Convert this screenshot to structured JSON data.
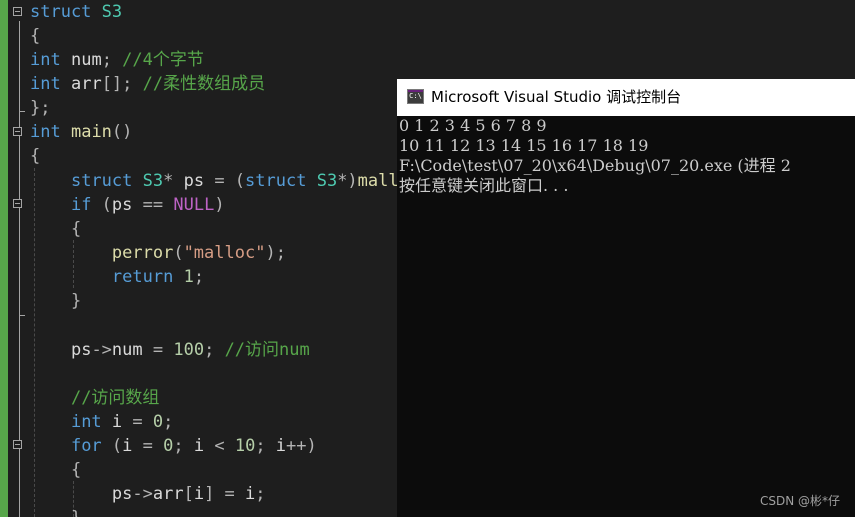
{
  "editor": {
    "lines": [
      {
        "tokens": [
          {
            "t": "struct",
            "c": "kw"
          },
          {
            "t": " "
          },
          {
            "t": "S3",
            "c": "ty"
          }
        ]
      },
      {
        "tokens": [
          {
            "t": "{",
            "c": "pn"
          }
        ]
      },
      {
        "tokens": [
          {
            "t": "int",
            "c": "kw"
          },
          {
            "t": " "
          },
          {
            "t": "num",
            "c": "id"
          },
          {
            "t": "; ",
            "c": "pn"
          },
          {
            "t": "//4个字节",
            "c": "cm"
          }
        ]
      },
      {
        "tokens": [
          {
            "t": "int",
            "c": "kw"
          },
          {
            "t": " "
          },
          {
            "t": "arr",
            "c": "id"
          },
          {
            "t": "[]; ",
            "c": "pn"
          },
          {
            "t": "//柔性数组成员",
            "c": "cm"
          }
        ]
      },
      {
        "tokens": [
          {
            "t": "};",
            "c": "pn"
          }
        ]
      },
      {
        "tokens": [
          {
            "t": "int",
            "c": "kw"
          },
          {
            "t": " "
          },
          {
            "t": "main",
            "c": "fn"
          },
          {
            "t": "()",
            "c": "pn"
          }
        ]
      },
      {
        "tokens": [
          {
            "t": "{",
            "c": "pn"
          }
        ]
      },
      {
        "tokens": [
          {
            "t": "    "
          },
          {
            "t": "struct",
            "c": "kw"
          },
          {
            "t": " "
          },
          {
            "t": "S3",
            "c": "ty"
          },
          {
            "t": "* ",
            "c": "pn"
          },
          {
            "t": "ps",
            "c": "id"
          },
          {
            "t": " = (",
            "c": "pn"
          },
          {
            "t": "struct",
            "c": "kw"
          },
          {
            "t": " "
          },
          {
            "t": "S3",
            "c": "ty"
          },
          {
            "t": "*)",
            "c": "pn"
          },
          {
            "t": "malloc",
            "c": "fn"
          }
        ]
      },
      {
        "tokens": [
          {
            "t": "    "
          },
          {
            "t": "if",
            "c": "kw"
          },
          {
            "t": " (",
            "c": "pn"
          },
          {
            "t": "ps",
            "c": "id"
          },
          {
            "t": " == ",
            "c": "pn"
          },
          {
            "t": "NULL",
            "c": "mac"
          },
          {
            "t": ")",
            "c": "pn"
          }
        ]
      },
      {
        "tokens": [
          {
            "t": "    "
          },
          {
            "t": "{",
            "c": "pn"
          }
        ]
      },
      {
        "tokens": [
          {
            "t": "        "
          },
          {
            "t": "perror",
            "c": "fn"
          },
          {
            "t": "(",
            "c": "pn"
          },
          {
            "t": "\"malloc\"",
            "c": "st"
          },
          {
            "t": ");",
            "c": "pn"
          }
        ]
      },
      {
        "tokens": [
          {
            "t": "        "
          },
          {
            "t": "return",
            "c": "kw"
          },
          {
            "t": " "
          },
          {
            "t": "1",
            "c": "nm"
          },
          {
            "t": ";",
            "c": "pn"
          }
        ]
      },
      {
        "tokens": [
          {
            "t": "    "
          },
          {
            "t": "}",
            "c": "pn"
          }
        ]
      },
      {
        "tokens": []
      },
      {
        "tokens": [
          {
            "t": "    "
          },
          {
            "t": "ps",
            "c": "id"
          },
          {
            "t": "->",
            "c": "pn"
          },
          {
            "t": "num",
            "c": "id"
          },
          {
            "t": " = ",
            "c": "pn"
          },
          {
            "t": "100",
            "c": "nm"
          },
          {
            "t": "; ",
            "c": "pn"
          },
          {
            "t": "//访问num",
            "c": "cm"
          }
        ]
      },
      {
        "tokens": []
      },
      {
        "tokens": [
          {
            "t": "    "
          },
          {
            "t": "//访问数组",
            "c": "cm"
          }
        ]
      },
      {
        "tokens": [
          {
            "t": "    "
          },
          {
            "t": "int",
            "c": "kw"
          },
          {
            "t": " "
          },
          {
            "t": "i",
            "c": "id"
          },
          {
            "t": " = ",
            "c": "pn"
          },
          {
            "t": "0",
            "c": "nm"
          },
          {
            "t": ";",
            "c": "pn"
          }
        ]
      },
      {
        "tokens": [
          {
            "t": "    "
          },
          {
            "t": "for",
            "c": "kw"
          },
          {
            "t": " (",
            "c": "pn"
          },
          {
            "t": "i",
            "c": "id"
          },
          {
            "t": " = ",
            "c": "pn"
          },
          {
            "t": "0",
            "c": "nm"
          },
          {
            "t": "; ",
            "c": "pn"
          },
          {
            "t": "i",
            "c": "id"
          },
          {
            "t": " < ",
            "c": "pn"
          },
          {
            "t": "10",
            "c": "nm"
          },
          {
            "t": "; ",
            "c": "pn"
          },
          {
            "t": "i",
            "c": "id"
          },
          {
            "t": "++)",
            "c": "pn"
          }
        ]
      },
      {
        "tokens": [
          {
            "t": "    "
          },
          {
            "t": "{",
            "c": "pn"
          }
        ]
      },
      {
        "tokens": [
          {
            "t": "        "
          },
          {
            "t": "ps",
            "c": "id"
          },
          {
            "t": "->",
            "c": "pn"
          },
          {
            "t": "arr",
            "c": "id"
          },
          {
            "t": "[",
            "c": "pn"
          },
          {
            "t": "i",
            "c": "id"
          },
          {
            "t": "] = ",
            "c": "pn"
          },
          {
            "t": "i",
            "c": "id"
          },
          {
            "t": ";",
            "c": "pn"
          }
        ]
      },
      {
        "tokens": [
          {
            "t": "    "
          },
          {
            "t": "}",
            "c": "pn"
          }
        ]
      }
    ]
  },
  "console": {
    "title": "Microsoft Visual Studio 调试控制台",
    "icon_text": "C:\\",
    "lines": [
      "0 1 2 3 4 5 6 7 8 9",
      "10 11 12 13 14 15 16 17 18 19",
      "F:\\Code\\test\\07_20\\x64\\Debug\\07_20.exe (进程 2",
      "按任意键关闭此窗口. . ."
    ]
  },
  "watermark": "CSDN @彬*仔",
  "colors": {
    "editor_bg": "#1e1e1e",
    "keyword": "#569cd6",
    "comment": "#57a64a",
    "type": "#4ec9b0",
    "string": "#d69d85",
    "number": "#b5cea8",
    "macro": "#bd63c5",
    "function": "#dcdcaa",
    "console_bg": "#0c0c0c",
    "console_text": "#cccccc",
    "change_bar": "#57a64a"
  }
}
